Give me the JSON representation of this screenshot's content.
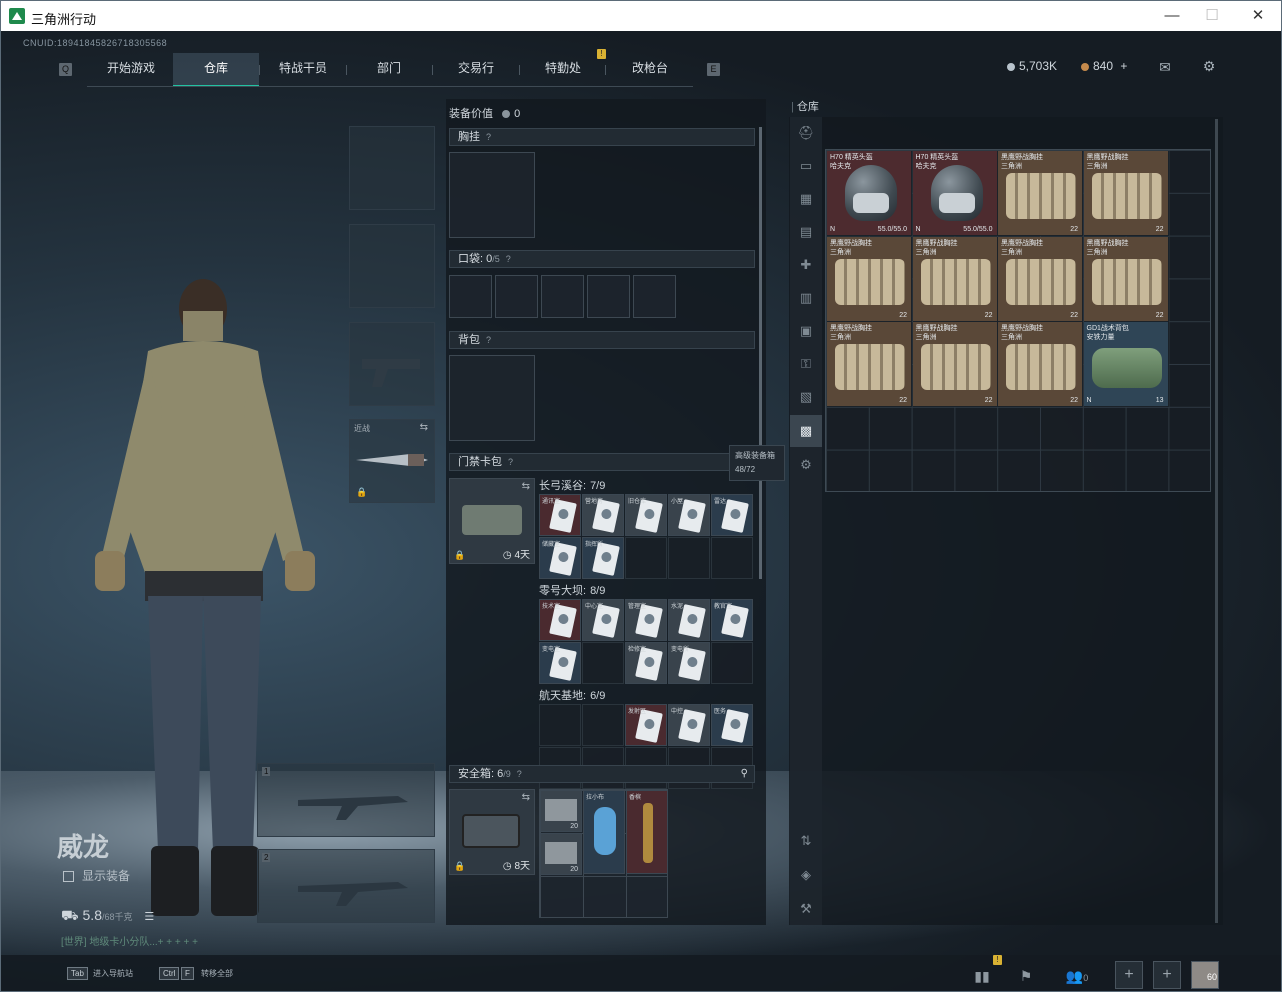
{
  "window": {
    "title": "三角洲行动",
    "min": "—",
    "max": "☐",
    "close": "✕"
  },
  "cnuid": "CNUID:18941845826718305568",
  "nav": {
    "tabs": [
      "开始游戏",
      "仓库",
      "特战干员",
      "部门",
      "交易行",
      "特勤处",
      "改枪台"
    ],
    "active": "仓库",
    "left_key": "Q",
    "right_key": "E",
    "alert_badge": "!"
  },
  "currency": {
    "silver": "5,703K",
    "coupon": "840",
    "coupon_add": "+"
  },
  "operator": {
    "name": "威龙",
    "show_equipment": "显示装备",
    "weight": "5.8",
    "weight_max": "/68千克",
    "status": "[世界] 地级卡小分队...+ + + + +"
  },
  "loadout": {
    "melee_label": "近战",
    "slot1_num": "1",
    "slot2_num": "2"
  },
  "equipment_panel": {
    "value_label": "装备价值",
    "value": "0",
    "chest_rig": "胸挂",
    "pockets_label": "口袋:",
    "pockets_used": "0",
    "pockets_max": "/5",
    "backpack": "背包",
    "keycard_label": "门禁卡包",
    "keycard_days": "4天",
    "groups": [
      {
        "name": "长弓溪谷:",
        "count": "7/9",
        "cards": [
          "通讯室",
          "营地房",
          "旧仓库",
          "小屋",
          "雷达",
          "储藏室",
          "指挥所",
          "",
          "",
          ""
        ]
      },
      {
        "name": "零号大坝:",
        "count": "8/9",
        "cards": [
          "技术室",
          "中心室",
          "管理室",
          "水泥",
          "教官室",
          "变电室",
          "",
          "检修室",
          "变电所",
          ""
        ]
      },
      {
        "name": "航天基地:",
        "count": "6/9",
        "cards": [
          "",
          "",
          "发射区",
          "中控",
          "医务",
          "",
          "",
          "",
          "",
          ""
        ]
      }
    ],
    "safe_box_label": "安全箱:",
    "safe_box_used": "6",
    "safe_box_max": "/9",
    "safe_box_days": "8天",
    "safe_items": [
      {
        "name": "",
        "count": "20"
      },
      {
        "name": "拉小布",
        "count": ""
      },
      {
        "name": "香槟",
        "count": ""
      },
      {
        "name": "",
        "count": "20"
      }
    ]
  },
  "warehouse": {
    "title": "仓库",
    "tooltip_title": "高级装备箱",
    "tooltip_value": "48/72",
    "items": [
      {
        "name": "H70 精英头盔",
        "sub": "哈夫克",
        "bg": "red",
        "kind": "helmet",
        "dura": "55.0/55.0",
        "tag": "N"
      },
      {
        "name": "H70 精英头盔",
        "sub": "哈夫克",
        "bg": "red",
        "kind": "helmet",
        "dura": "55.0/55.0",
        "tag": "N"
      },
      {
        "name": "黑鹰野战胸挂",
        "sub": "三角洲",
        "bg": "brown",
        "kind": "rig",
        "dura": "22",
        "tag": ""
      },
      {
        "name": "黑鹰野战胸挂",
        "sub": "三角洲",
        "bg": "brown",
        "kind": "rig",
        "dura": "22",
        "tag": ""
      },
      {
        "name": "黑鹰野战胸挂",
        "sub": "三角洲",
        "bg": "brown",
        "kind": "rig",
        "dura": "22",
        "tag": ""
      },
      {
        "name": "黑鹰野战胸挂",
        "sub": "三角洲",
        "bg": "brown",
        "kind": "rig",
        "dura": "22",
        "tag": ""
      },
      {
        "name": "黑鹰野战胸挂",
        "sub": "三角洲",
        "bg": "brown",
        "kind": "rig",
        "dura": "22",
        "tag": ""
      },
      {
        "name": "黑鹰野战胸挂",
        "sub": "三角洲",
        "bg": "brown",
        "kind": "rig",
        "dura": "22",
        "tag": ""
      },
      {
        "name": "黑鹰野战胸挂",
        "sub": "三角洲",
        "bg": "brown",
        "kind": "rig",
        "dura": "22",
        "tag": ""
      },
      {
        "name": "黑鹰野战胸挂",
        "sub": "三角洲",
        "bg": "brown",
        "kind": "rig",
        "dura": "22",
        "tag": ""
      },
      {
        "name": "黑鹰野战胸挂",
        "sub": "三角洲",
        "bg": "brown",
        "kind": "rig",
        "dura": "22",
        "tag": ""
      },
      {
        "name": "GD1战术背包",
        "sub": "安铁力量",
        "bg": "blue",
        "kind": "duffel",
        "dura": "13",
        "tag": "N"
      }
    ]
  },
  "bottom_bar": {
    "tab_key": "Tab",
    "tab_label": "进入导航站",
    "ctrl_key": "Ctrl",
    "f_key": "F",
    "ctrl_label": "转移全部",
    "party_count": "0",
    "avatar_level": "60",
    "alert_badge": "!"
  }
}
